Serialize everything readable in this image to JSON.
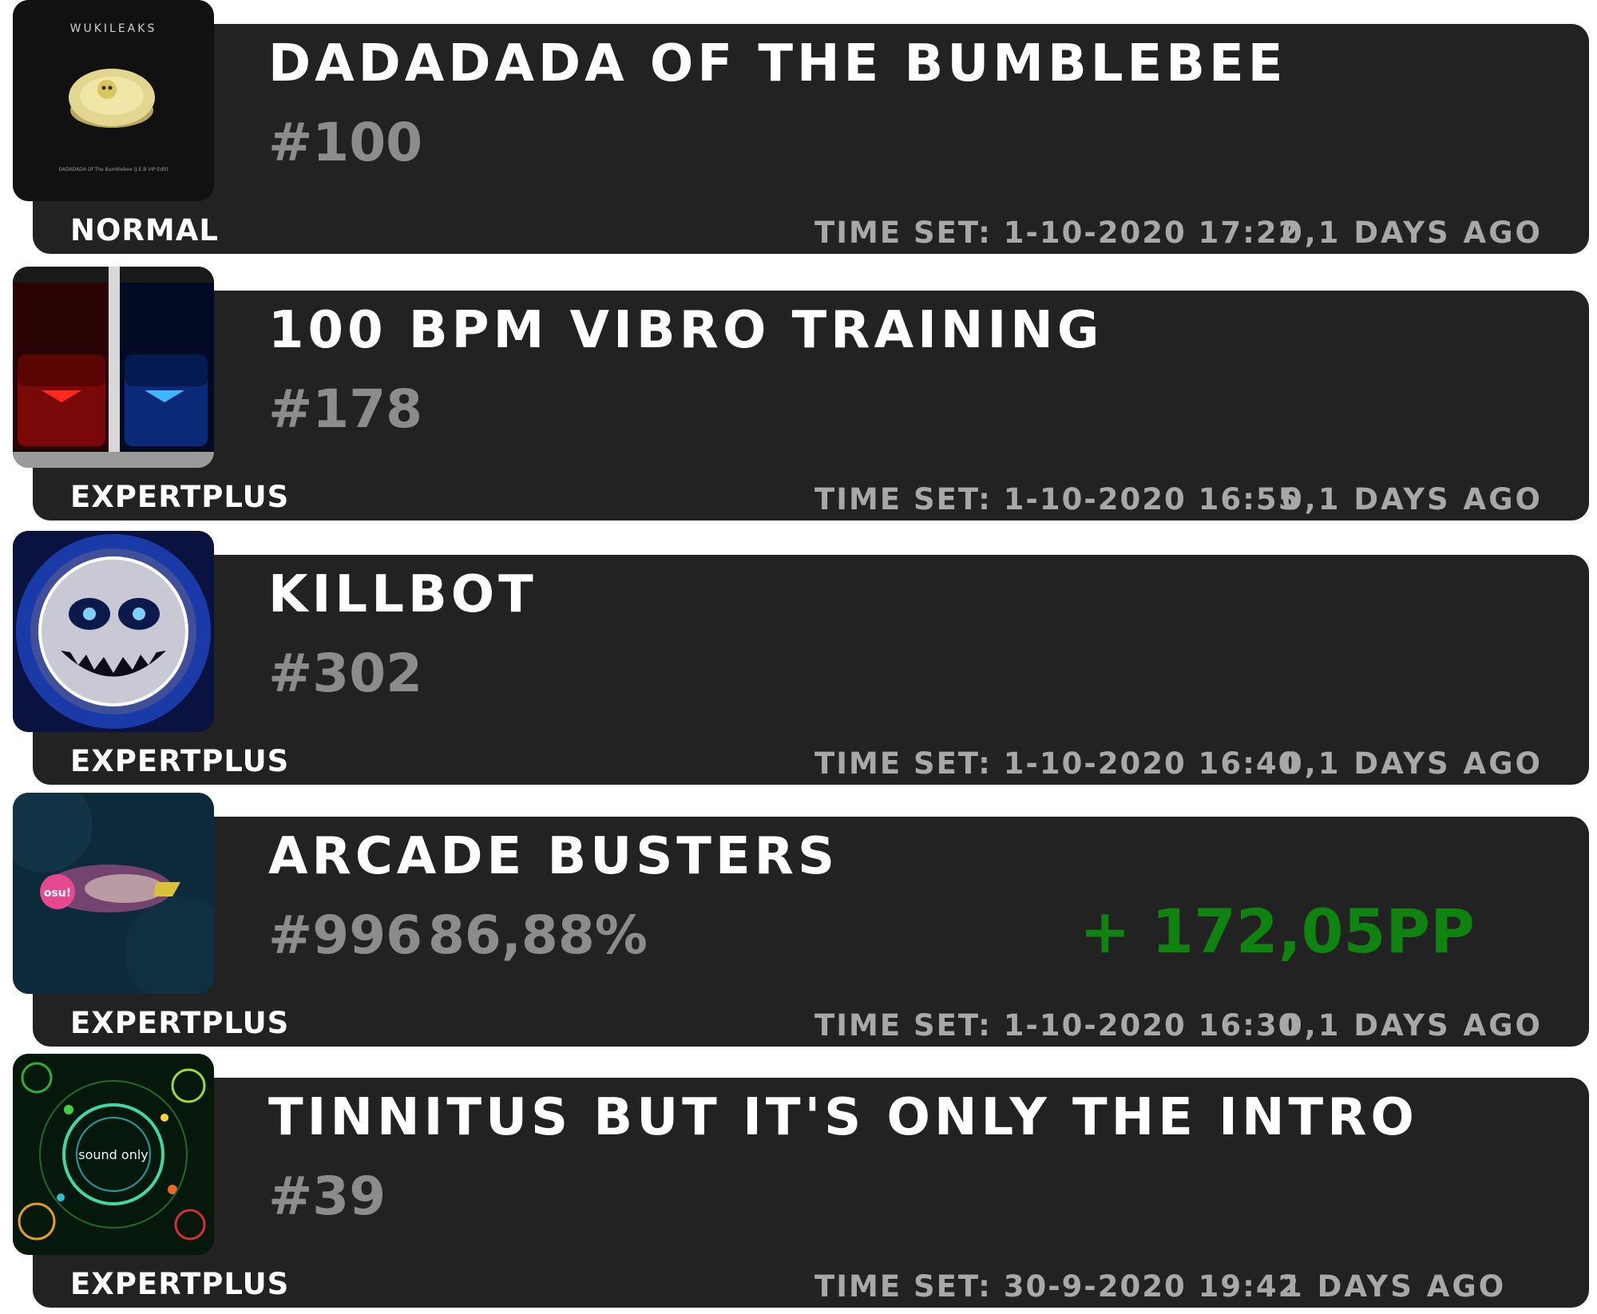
{
  "colors": {
    "card_background": "#222222",
    "title": "#ffffff",
    "rank": "#8c8c8c",
    "meta": "#a8a8a8",
    "pp_gain": "#0f820f"
  },
  "scores": [
    {
      "title": "DADADADA OF THE BUMBLEBEE",
      "rank": "#100",
      "difficulty": "NORMAL",
      "time_set": "TIME SET: 1-10-2020 17:22",
      "ago": "0,1 DAYS AGO",
      "cover_icon": "bumblebee-cover-icon",
      "cover_label": "WUKILEAKS",
      "cover_caption": "DADADADA Of The Bumblebee (J.E.B VIP Edit)"
    },
    {
      "title": "100 BPM VIBRO TRAINING",
      "rank": "#178",
      "difficulty": "EXPERTPLUS",
      "time_set": "TIME SET: 1-10-2020 16:55",
      "ago": "0,1 DAYS AGO",
      "cover_icon": "beat-saber-blocks-cover-icon"
    },
    {
      "title": "KILLBOT",
      "rank": "#302",
      "difficulty": "EXPERTPLUS",
      "time_set": "TIME SET: 1-10-2020 16:40",
      "ago": "0,1 DAYS AGO",
      "cover_icon": "killbot-face-cover-icon"
    },
    {
      "title": "ARCADE BUSTERS",
      "rank": "#996",
      "accuracy": "86,88%",
      "pp": "+ 172,05PP",
      "difficulty": "EXPERTPLUS",
      "time_set": "TIME SET: 1-10-2020 16:30",
      "ago": "0,1 DAYS AGO",
      "cover_icon": "osu-arcade-cover-icon",
      "cover_label": "osu!"
    },
    {
      "title": "TINNITUS BUT IT'S ONLY THE INTRO",
      "rank": "#39",
      "difficulty": "EXPERTPLUS",
      "time_set": "TIME SET: 30-9-2020 19:42",
      "ago": "1 DAYS AGO",
      "cover_icon": "sound-only-rings-cover-icon",
      "cover_label": "sound only"
    }
  ]
}
